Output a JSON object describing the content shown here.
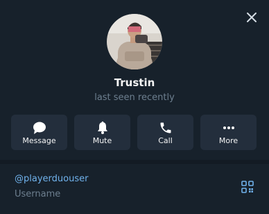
{
  "profile": {
    "name": "Trustin",
    "status": "last seen recently"
  },
  "actions": [
    {
      "label": "Message",
      "icon": "chat-bubble-icon"
    },
    {
      "label": "Mute",
      "icon": "bell-icon"
    },
    {
      "label": "Call",
      "icon": "phone-icon"
    },
    {
      "label": "More",
      "icon": "more-dots-icon"
    }
  ],
  "info": {
    "username": "@playerduouser",
    "username_label": "Username"
  },
  "colors": {
    "background": "#17212b",
    "button_bg": "#232e3c",
    "link": "#70b2ec",
    "muted": "#6d7f8f",
    "text": "#f5f5f5"
  }
}
